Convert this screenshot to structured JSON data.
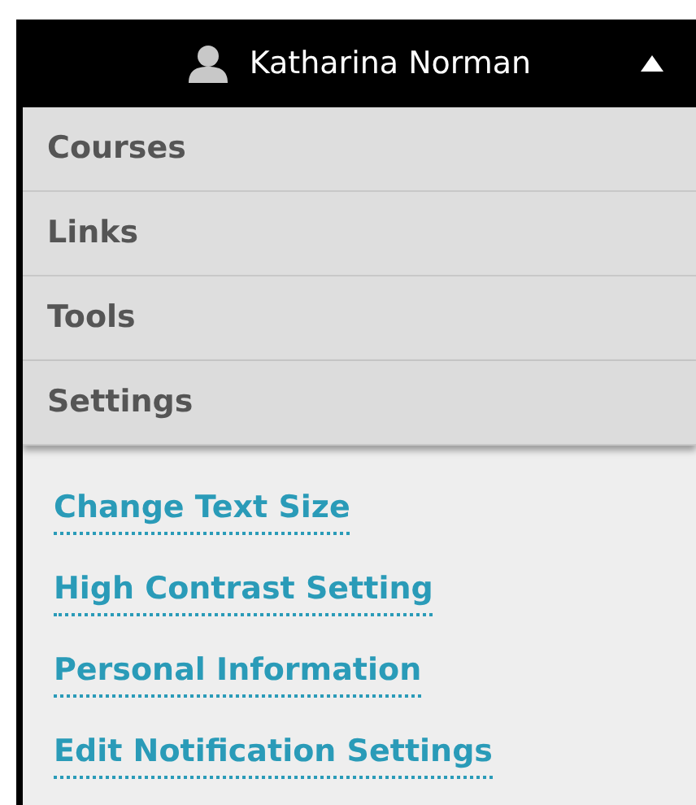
{
  "user_menu": {
    "name": "Katharina Norman",
    "expanded": true
  },
  "sections": [
    {
      "label": "Courses"
    },
    {
      "label": "Links"
    },
    {
      "label": "Tools"
    },
    {
      "label": "Settings",
      "links": [
        "Change Text Size",
        "High Contrast Setting",
        "Personal Information",
        "Edit Notification Settings"
      ]
    }
  ]
}
